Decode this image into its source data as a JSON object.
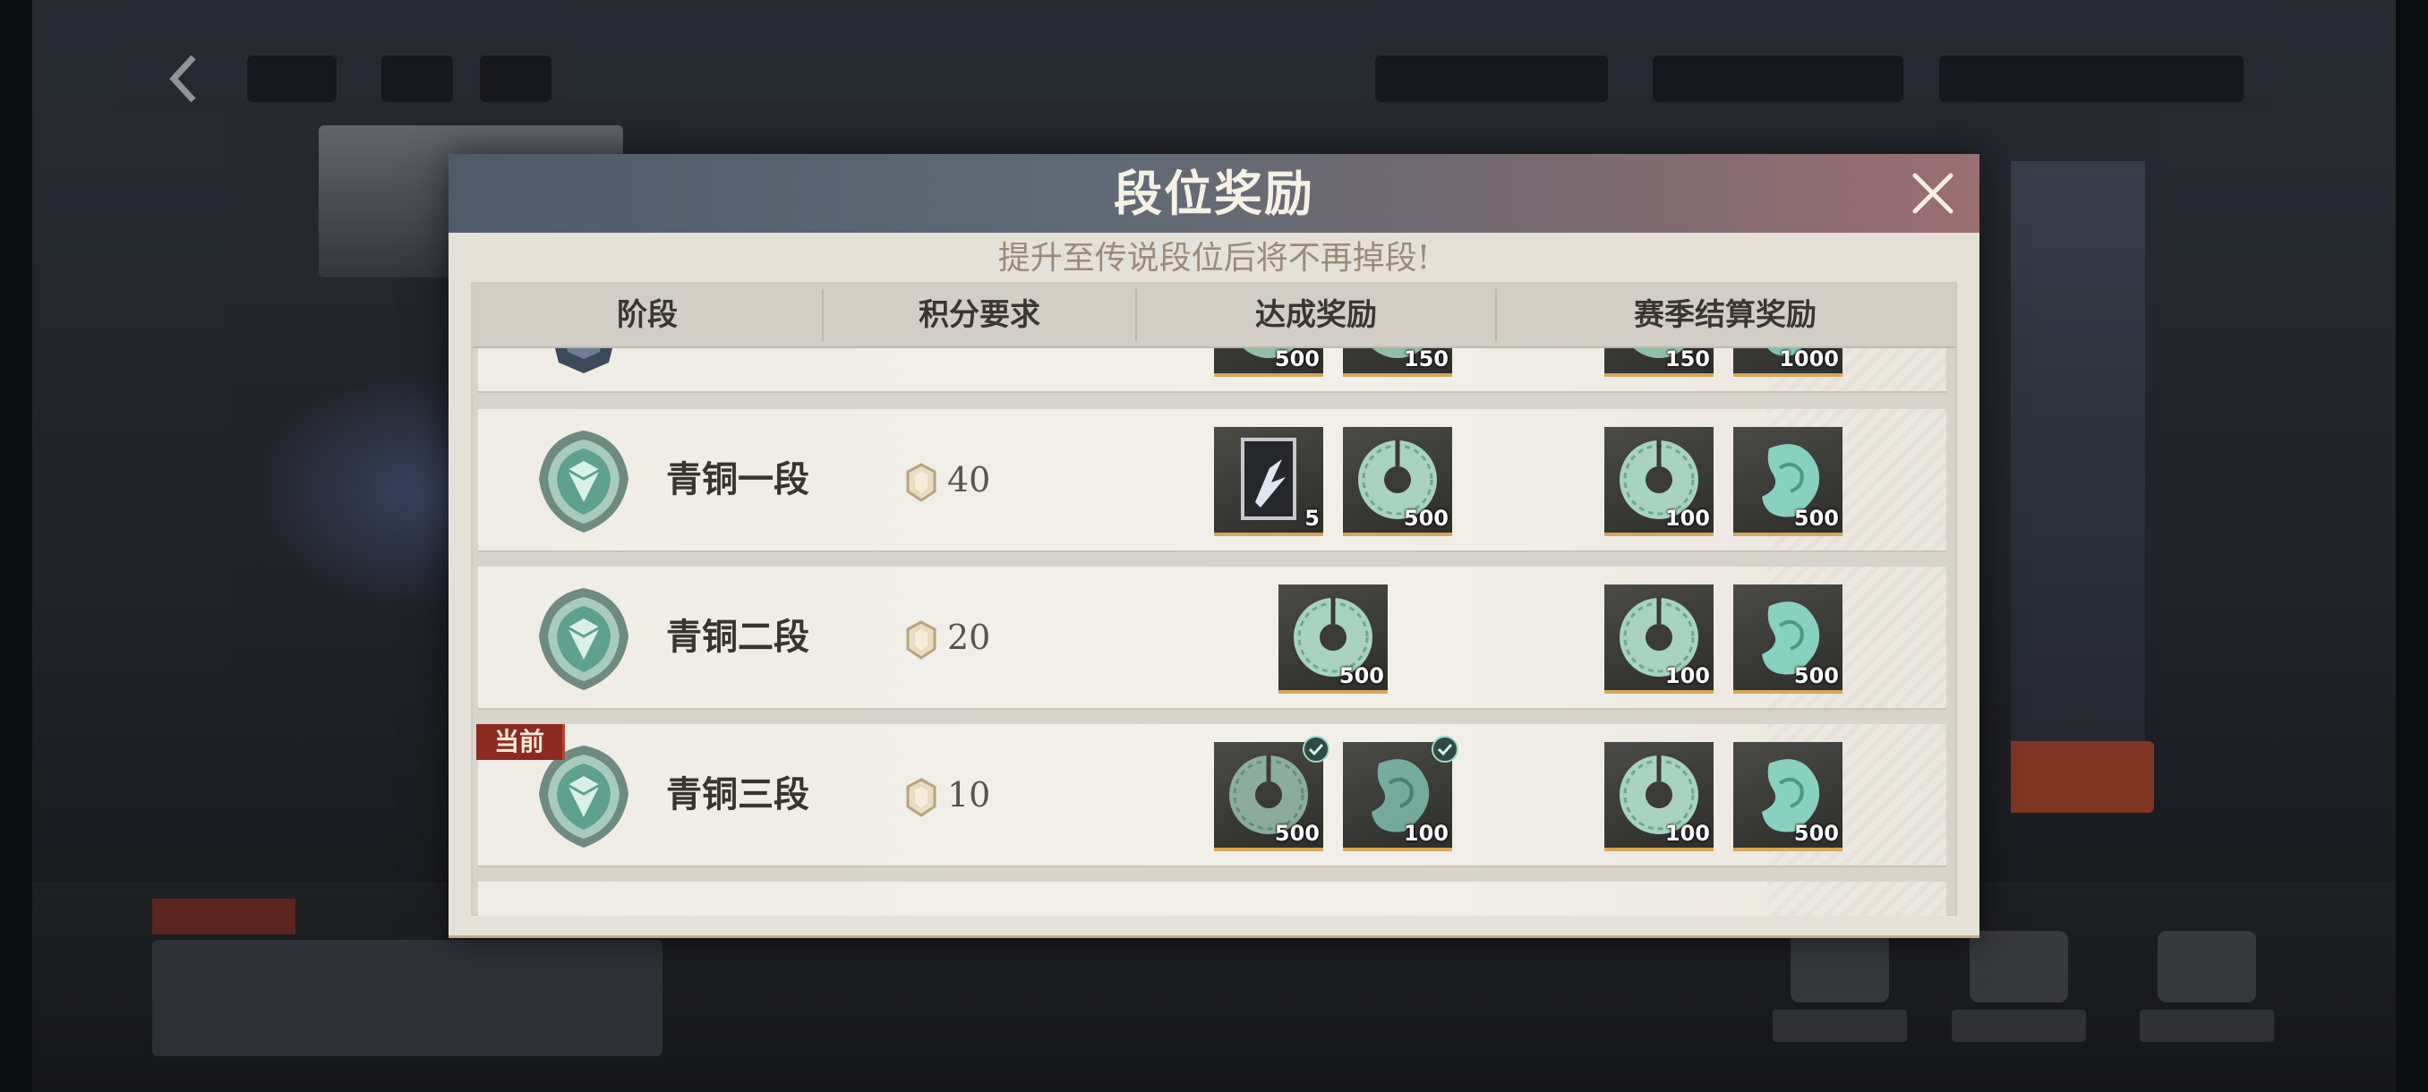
{
  "modal": {
    "title": "段位奖励",
    "subtitle": "提升至传说段位后将不再掉段!",
    "close_icon": "close-icon"
  },
  "table": {
    "headers": [
      "阶段",
      "积分要求",
      "达成奖励",
      "赛季结算奖励"
    ],
    "rows": [
      {
        "rank_name": "",
        "points": "",
        "emblem": "silver",
        "rewards": [
          {
            "icon": "jade-disc-icon",
            "qty": "500"
          },
          {
            "icon": "jade-disc-icon",
            "qty": "150"
          }
        ],
        "season_rewards": [
          {
            "icon": "jade-disc-icon",
            "qty": "150"
          },
          {
            "icon": "jade-dragon-icon",
            "qty": "1000"
          }
        ]
      },
      {
        "rank_name": "青铜一段",
        "points": "40",
        "emblem": "bronze",
        "rewards": [
          {
            "icon": "card-frame-icon",
            "qty": "5"
          },
          {
            "icon": "jade-disc-icon",
            "qty": "500"
          }
        ],
        "season_rewards": [
          {
            "icon": "jade-disc-icon",
            "qty": "100"
          },
          {
            "icon": "jade-dragon-icon",
            "qty": "500"
          }
        ]
      },
      {
        "rank_name": "青铜二段",
        "points": "20",
        "emblem": "bronze",
        "rewards": [
          {
            "icon": "jade-disc-icon",
            "qty": "500"
          }
        ],
        "season_rewards": [
          {
            "icon": "jade-disc-icon",
            "qty": "100"
          },
          {
            "icon": "jade-dragon-icon",
            "qty": "500"
          }
        ]
      },
      {
        "rank_name": "青铜三段",
        "points": "10",
        "emblem": "bronze",
        "current_label": "当前",
        "rewards": [
          {
            "icon": "jade-disc-icon",
            "qty": "500",
            "claimed": true
          },
          {
            "icon": "jade-dragon-icon",
            "qty": "100",
            "claimed": true
          }
        ],
        "season_rewards": [
          {
            "icon": "jade-disc-icon",
            "qty": "100"
          },
          {
            "icon": "jade-dragon-icon",
            "qty": "500"
          }
        ]
      }
    ]
  },
  "colors": {
    "header_gradient_left": "#4e5c6a",
    "header_gradient_right": "#9a6e72",
    "panel_bg": "#e6e1d8",
    "current_badge": "#8c2a22",
    "reward_underline": "#d6a65a"
  }
}
